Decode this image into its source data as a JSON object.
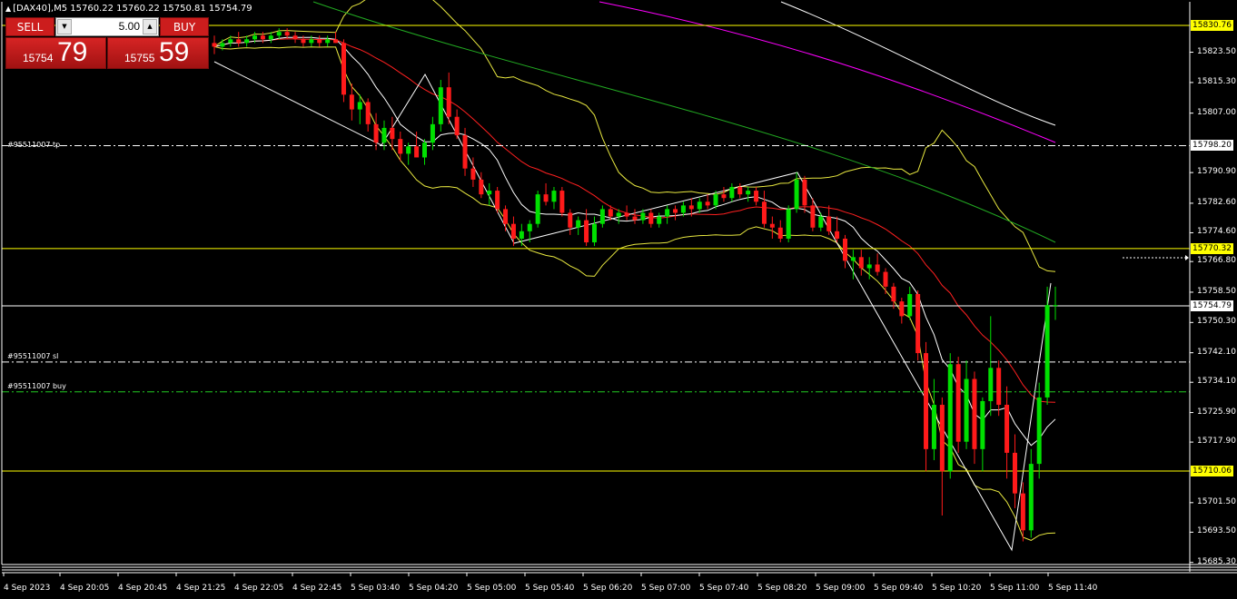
{
  "chart_title": "[DAX40],M5  15760.22 15760.22 15750.81 15754.79",
  "trade_panel": {
    "sell_label": "SELL",
    "buy_label": "BUY",
    "lot_value": "5.00",
    "bid_small": "15754",
    "bid_big": "79",
    "ask_small": "15755",
    "ask_big": "59"
  },
  "order_labels": {
    "tp": "#95511007 tp",
    "sl": "#95511007 sl",
    "buy": "#95511007 buy"
  },
  "price_tags": [
    {
      "price": 15830.76,
      "text": "15830.76",
      "style": "yellow"
    },
    {
      "price": 15798.2,
      "text": "15798.20",
      "style": "white"
    },
    {
      "price": 15770.32,
      "text": "15770.32",
      "style": "yellow"
    },
    {
      "price": 15754.79,
      "text": "15754.79",
      "style": "white"
    },
    {
      "price": 15710.06,
      "text": "15710.06",
      "style": "yellow"
    }
  ],
  "colors": {
    "background": "#000000",
    "bull": "#00e000",
    "bear": "#ff1a1a",
    "hline": "#ffff00",
    "ma_red": "#ff2020",
    "ma_green": "#22aa22",
    "ma_magenta": "#ff00ff",
    "ma_white": "#ffffff",
    "bands": "#e8e840"
  },
  "chart_data": {
    "type": "candlestick",
    "symbol": "[DAX40]",
    "timeframe": "M5",
    "y_ticks": [
      "15823.50",
      "15815.30",
      "15807.00",
      "15790.90",
      "15782.60",
      "15774.60",
      "15766.80",
      "15758.50",
      "15750.30",
      "15742.10",
      "15734.10",
      "15725.90",
      "15717.90",
      "15701.50",
      "15693.50",
      "15685.30"
    ],
    "x_ticks": [
      "4 Sep 2023",
      "4 Sep 20:05",
      "4 Sep 20:45",
      "4 Sep 21:25",
      "4 Sep 22:05",
      "4 Sep 22:45",
      "5 Sep 03:40",
      "5 Sep 04:20",
      "5 Sep 05:00",
      "5 Sep 05:40",
      "5 Sep 06:20",
      "5 Sep 07:00",
      "5 Sep 07:40",
      "5 Sep 08:20",
      "5 Sep 09:00",
      "5 Sep 09:40",
      "5 Sep 10:20",
      "5 Sep 11:00",
      "5 Sep 11:40"
    ],
    "horizontal_lines": [
      15830.76,
      15770.32,
      15754.79,
      15710.06
    ],
    "order_lines": {
      "tp": 15798.2,
      "sl": 15739.6,
      "buy": 15731.5
    },
    "ylim": [
      15682,
      15837
    ],
    "ohlc": [
      [
        15826,
        15828,
        15823,
        15825
      ],
      [
        15825,
        15827,
        15824,
        15826
      ],
      [
        15826,
        15828,
        15825,
        15827
      ],
      [
        15827,
        15829,
        15825,
        15826
      ],
      [
        15826,
        15828,
        15825,
        15827
      ],
      [
        15827,
        15829,
        15826,
        15828
      ],
      [
        15828,
        15829,
        15826,
        15827
      ],
      [
        15827,
        15829,
        15826,
        15828
      ],
      [
        15828,
        15830,
        15827,
        15829
      ],
      [
        15829,
        15830,
        15827,
        15828
      ],
      [
        15828,
        15829,
        15826,
        15827
      ],
      [
        15827,
        15828,
        15825,
        15826
      ],
      [
        15826,
        15828,
        15825,
        15827
      ],
      [
        15827,
        15828,
        15825,
        15826
      ],
      [
        15826,
        15828,
        15825,
        15827
      ],
      [
        15827,
        15829,
        15826,
        15826
      ],
      [
        15826,
        15827,
        15810,
        15812
      ],
      [
        15812,
        15815,
        15805,
        15808
      ],
      [
        15808,
        15812,
        15804,
        15810
      ],
      [
        15810,
        15811,
        15802,
        15804
      ],
      [
        15804,
        15807,
        15797,
        15799
      ],
      [
        15799,
        15805,
        15797,
        15803
      ],
      [
        15803,
        15806,
        15797,
        15800
      ],
      [
        15800,
        15802,
        15794,
        15796
      ],
      [
        15796,
        15799,
        15793,
        15798
      ],
      [
        15798,
        15802,
        15795,
        15795
      ],
      [
        15795,
        15800,
        15793,
        15799
      ],
      [
        15799,
        15806,
        15797,
        15804
      ],
      [
        15804,
        15816,
        15802,
        15814
      ],
      [
        15814,
        15818,
        15804,
        15806
      ],
      [
        15806,
        15808,
        15800,
        15801
      ],
      [
        15801,
        15803,
        15790,
        15792
      ],
      [
        15792,
        15795,
        15787,
        15789
      ],
      [
        15789,
        15791,
        15784,
        15785
      ],
      [
        15785,
        15788,
        15782,
        15786
      ],
      [
        15786,
        15787,
        15780,
        15781
      ],
      [
        15781,
        15782,
        15775,
        15777
      ],
      [
        15777,
        15779,
        15771,
        15773
      ],
      [
        15773,
        15777,
        15771,
        15775
      ],
      [
        15775,
        15778,
        15772,
        15777
      ],
      [
        15777,
        15786,
        15776,
        15785
      ],
      [
        15785,
        15788,
        15782,
        15783
      ],
      [
        15783,
        15787,
        15781,
        15786
      ],
      [
        15786,
        15787,
        15779,
        15780
      ],
      [
        15780,
        15781,
        15774,
        15776
      ],
      [
        15776,
        15779,
        15774,
        15778
      ],
      [
        15778,
        15781,
        15771,
        15772
      ],
      [
        15772,
        15779,
        15771,
        15777
      ],
      [
        15777,
        15782,
        15776,
        15781
      ],
      [
        15781,
        15782,
        15778,
        15779
      ],
      [
        15779,
        15781,
        15777,
        15780
      ],
      [
        15780,
        15782,
        15778,
        15779
      ],
      [
        15779,
        15781,
        15777,
        15778
      ],
      [
        15778,
        15781,
        15777,
        15780
      ],
      [
        15780,
        15781,
        15776,
        15777
      ],
      [
        15777,
        15780,
        15776,
        15779
      ],
      [
        15779,
        15782,
        15777,
        15781
      ],
      [
        15781,
        15782,
        15778,
        15780
      ],
      [
        15780,
        15783,
        15779,
        15782
      ],
      [
        15782,
        15784,
        15779,
        15781
      ],
      [
        15781,
        15784,
        15780,
        15783
      ],
      [
        15783,
        15785,
        15781,
        15782
      ],
      [
        15782,
        15786,
        15781,
        15785
      ],
      [
        15785,
        15787,
        15783,
        15784
      ],
      [
        15784,
        15788,
        15783,
        15787
      ],
      [
        15787,
        15788,
        15784,
        15785
      ],
      [
        15785,
        15787,
        15783,
        15786
      ],
      [
        15786,
        15787,
        15782,
        15783
      ],
      [
        15783,
        15786,
        15776,
        15777
      ],
      [
        15777,
        15779,
        15773,
        15776
      ],
      [
        15776,
        15778,
        15772,
        15773
      ],
      [
        15773,
        15782,
        15772,
        15781
      ],
      [
        15781,
        15791,
        15780,
        15789
      ],
      [
        15789,
        15790,
        15780,
        15782
      ],
      [
        15782,
        15784,
        15775,
        15776
      ],
      [
        15776,
        15780,
        15775,
        15779
      ],
      [
        15779,
        15782,
        15774,
        15775
      ],
      [
        15775,
        15779,
        15772,
        15773
      ],
      [
        15773,
        15774,
        15765,
        15767
      ],
      [
        15767,
        15770,
        15762,
        15768
      ],
      [
        15768,
        15770,
        15763,
        15765
      ],
      [
        15765,
        15768,
        15762,
        15766
      ],
      [
        15766,
        15769,
        15763,
        15764
      ],
      [
        15764,
        15765,
        15758,
        15760
      ],
      [
        15760,
        15761,
        15754,
        15756
      ],
      [
        15756,
        15757,
        15750,
        15752
      ],
      [
        15752,
        15760,
        15751,
        15758
      ],
      [
        15758,
        15759,
        15740,
        15742
      ],
      [
        15742,
        15745,
        15710,
        15716
      ],
      [
        15716,
        15735,
        15713,
        15728
      ],
      [
        15728,
        15730,
        15698,
        15710
      ],
      [
        15710,
        15742,
        15708,
        15739
      ],
      [
        15739,
        15741,
        15715,
        15718
      ],
      [
        15718,
        15740,
        15716,
        15735
      ],
      [
        15735,
        15737,
        15712,
        15716
      ],
      [
        15716,
        15730,
        15710,
        15729
      ],
      [
        15729,
        15752,
        15725,
        15738
      ],
      [
        15738,
        15740,
        15725,
        15728
      ],
      [
        15728,
        15733,
        15708,
        15715
      ],
      [
        15715,
        15720,
        15700,
        15704
      ],
      [
        15704,
        15707,
        15691,
        15694
      ],
      [
        15694,
        15716,
        15692,
        15712
      ],
      [
        15712,
        15734,
        15708,
        15730
      ],
      [
        15730,
        15760,
        15728,
        15755
      ],
      [
        15755,
        15760,
        15751,
        15755
      ]
    ]
  }
}
